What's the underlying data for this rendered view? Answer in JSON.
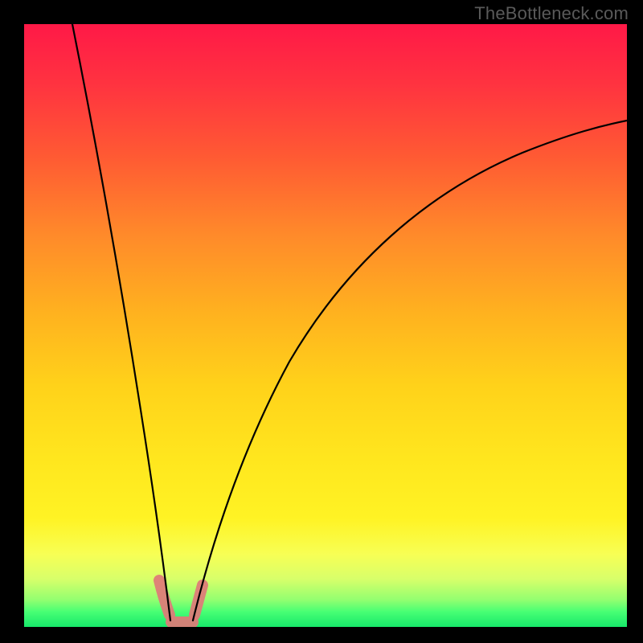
{
  "watermark": "TheBottleneck.com",
  "colors": {
    "page_bg": "#000000",
    "frame": "#000000",
    "watermark_text": "#5a5a5a",
    "curve": "#000000",
    "highlight": "#e07878",
    "gradient_stops": [
      {
        "offset": 0.0,
        "color": "#ff1947"
      },
      {
        "offset": 0.1,
        "color": "#ff3340"
      },
      {
        "offset": 0.22,
        "color": "#ff5a33"
      },
      {
        "offset": 0.35,
        "color": "#ff8a2a"
      },
      {
        "offset": 0.48,
        "color": "#ffb21f"
      },
      {
        "offset": 0.6,
        "color": "#ffd21a"
      },
      {
        "offset": 0.72,
        "color": "#ffe61e"
      },
      {
        "offset": 0.82,
        "color": "#fff324"
      },
      {
        "offset": 0.88,
        "color": "#f7ff55"
      },
      {
        "offset": 0.92,
        "color": "#d8ff6a"
      },
      {
        "offset": 0.955,
        "color": "#93ff70"
      },
      {
        "offset": 0.975,
        "color": "#47ff74"
      },
      {
        "offset": 1.0,
        "color": "#17e86a"
      }
    ]
  },
  "chart_data": {
    "type": "line",
    "title": "",
    "xlabel": "",
    "ylabel": "",
    "xlim": [
      0,
      100
    ],
    "ylim": [
      0,
      100
    ],
    "grid": false,
    "legend": false,
    "note": "Bottleneck-style curve. x-axis: relative component balance (arbitrary 0–100). y-axis: bottleneck magnitude 0 (green, optimal) → 100 (red, severe). Curve is a V/funnel with minimum near x≈24–28 at y≈0. Values estimated from pixel positions; image has no numeric tick labels.",
    "series": [
      {
        "name": "left-branch",
        "x": [
          8,
          10,
          12,
          14,
          16,
          18,
          20,
          22,
          23.5,
          24.5
        ],
        "y": [
          100,
          88,
          76,
          63,
          50,
          37,
          24,
          11,
          4,
          0
        ]
      },
      {
        "name": "right-branch",
        "x": [
          27.5,
          29,
          31,
          34,
          38,
          43,
          49,
          56,
          64,
          73,
          83,
          94,
          100
        ],
        "y": [
          0,
          4,
          9,
          16,
          25,
          34,
          43,
          52,
          60,
          68,
          75,
          81,
          84
        ]
      }
    ],
    "highlight_region": {
      "description": "pink rounded segments marking the curve near its minimum",
      "x_range": [
        22.5,
        29.5
      ],
      "y_range": [
        0,
        8
      ]
    }
  }
}
